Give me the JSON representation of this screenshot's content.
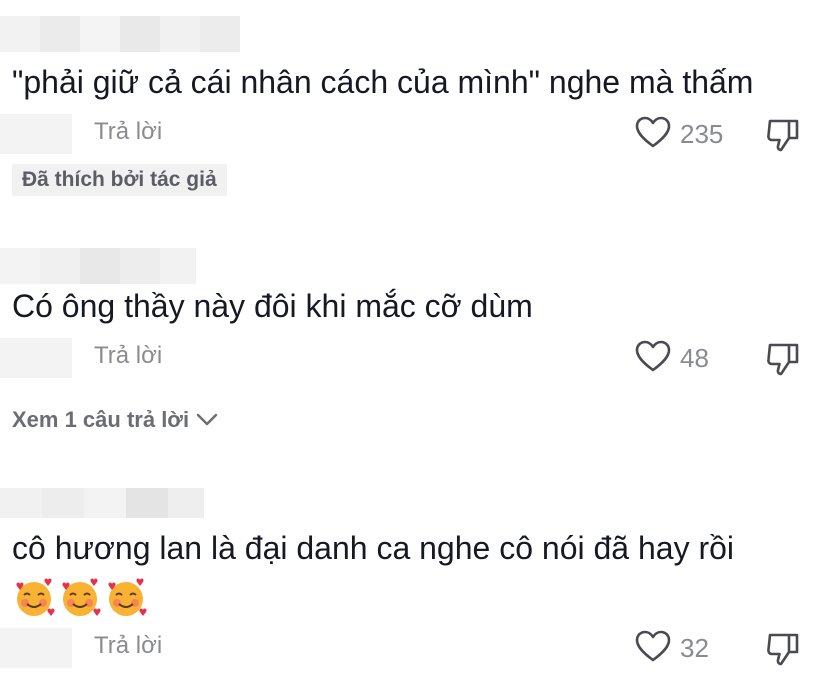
{
  "comments": [
    {
      "text": "\"phải giữ cả cái nhân cách của mình\" nghe mà thấm",
      "reply_label": "Trả lời",
      "likes": "235",
      "badge": "Đã thích bởi tác giả"
    },
    {
      "text": "Có ông thầy này đôi khi mắc cỡ dùm",
      "reply_label": "Trả lời",
      "likes": "48",
      "view_replies": "Xem 1 câu trả lời"
    },
    {
      "text": "cô hương lan là đại danh ca nghe cô nói đã hay rồi",
      "emojis": [
        "smiling-face-with-hearts",
        "smiling-face-with-hearts",
        "smiling-face-with-hearts"
      ],
      "reply_label": "Trả lời",
      "likes": "32"
    }
  ],
  "icons": {
    "like": "heart-outline-icon",
    "dislike": "thumbs-down-icon",
    "expand": "chevron-down-icon"
  },
  "colors": {
    "text_primary": "#161823",
    "text_secondary": "#8a8b91",
    "badge_bg": "#f1f1f2"
  }
}
